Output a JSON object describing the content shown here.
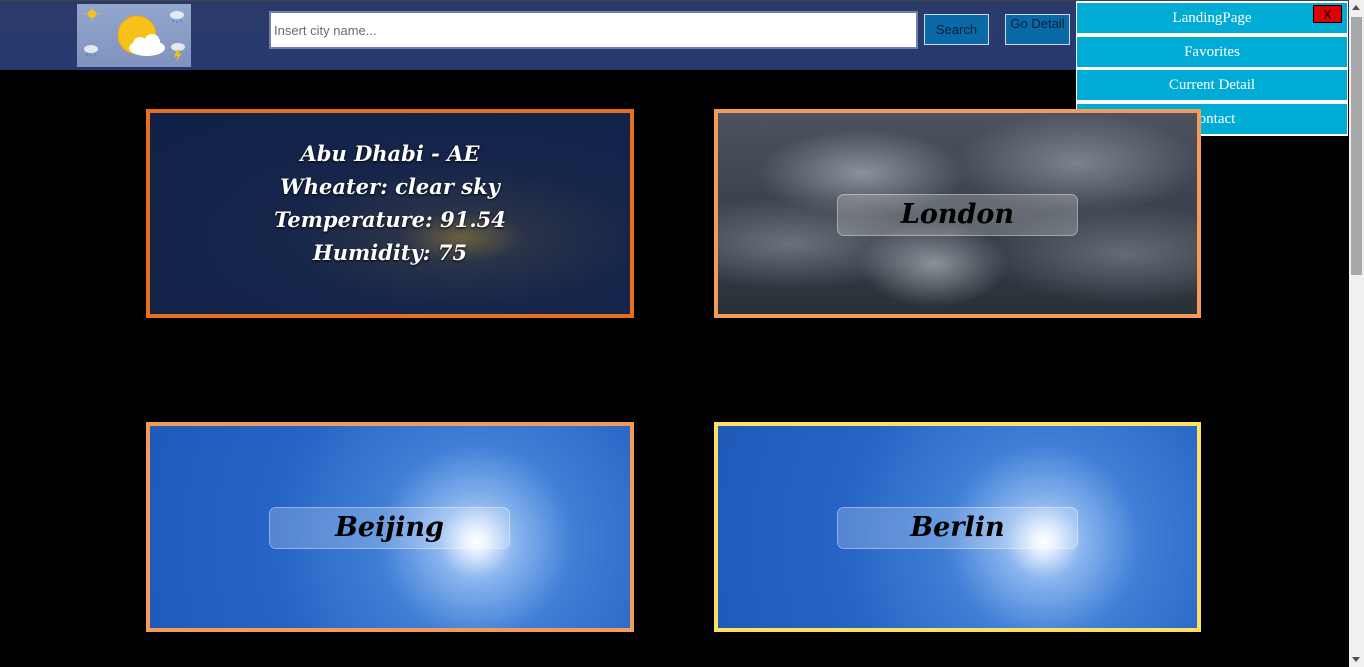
{
  "header": {
    "search": {
      "placeholder": "Insert city name...",
      "value": ""
    },
    "search_button": "Search",
    "detail_button": "Go Detail"
  },
  "menu": {
    "close_label": "X",
    "items": [
      {
        "label": "LandingPage"
      },
      {
        "label": "Favorites"
      },
      {
        "label": "Current Detail"
      },
      {
        "label": "Contact"
      }
    ]
  },
  "cards": {
    "abu_dhabi": {
      "title": "Abu Dhabi - AE",
      "weather": "Wheater: clear sky",
      "temperature": "Temperature: 91.54",
      "humidity": "Humidity: 75"
    },
    "london": {
      "label": "London"
    },
    "beijing": {
      "label": "Beijing"
    },
    "berlin": {
      "label": "Berlin"
    }
  },
  "colors": {
    "header_bg": "#2c3a6a",
    "menu_item_bg": "#00acd6",
    "button_bg": "#0a6aa8",
    "close_bg": "#e00000",
    "border_abu": "#e8701a",
    "border_london": "#f49a5a",
    "border_beijing": "#f49a5a",
    "border_berlin": "#ffe066"
  }
}
